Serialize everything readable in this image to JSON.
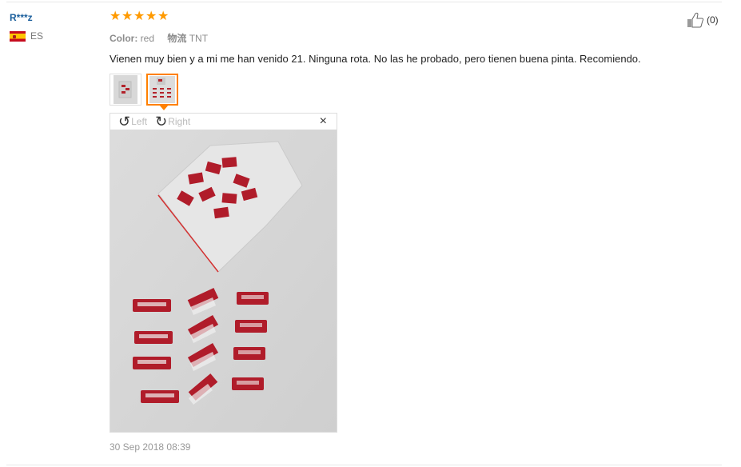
{
  "review": {
    "user": {
      "name": "R***z",
      "country": "ES"
    },
    "rating": 5,
    "meta": {
      "color_label": "Color:",
      "color_value": "red",
      "shipping_label": "物流",
      "shipping_value": "TNT"
    },
    "text": "Vienen muy bien y a mi me han venido 21. Ninguna rota. No las he probado, pero tienen buena pinta. Recomiendo.",
    "viewer": {
      "rotate_left": "Left",
      "rotate_right": "Right",
      "close": "×"
    },
    "date": "30 Sep 2018 08:39",
    "likes": "(0)"
  },
  "colors": {
    "star": "#ff9a00",
    "username": "#1a5e9c",
    "active_border": "#ff8000"
  },
  "icons": [
    "flag-es-icon",
    "star-icon",
    "rotate-left-icon",
    "rotate-right-icon",
    "close-icon",
    "thumbs-up-icon"
  ]
}
